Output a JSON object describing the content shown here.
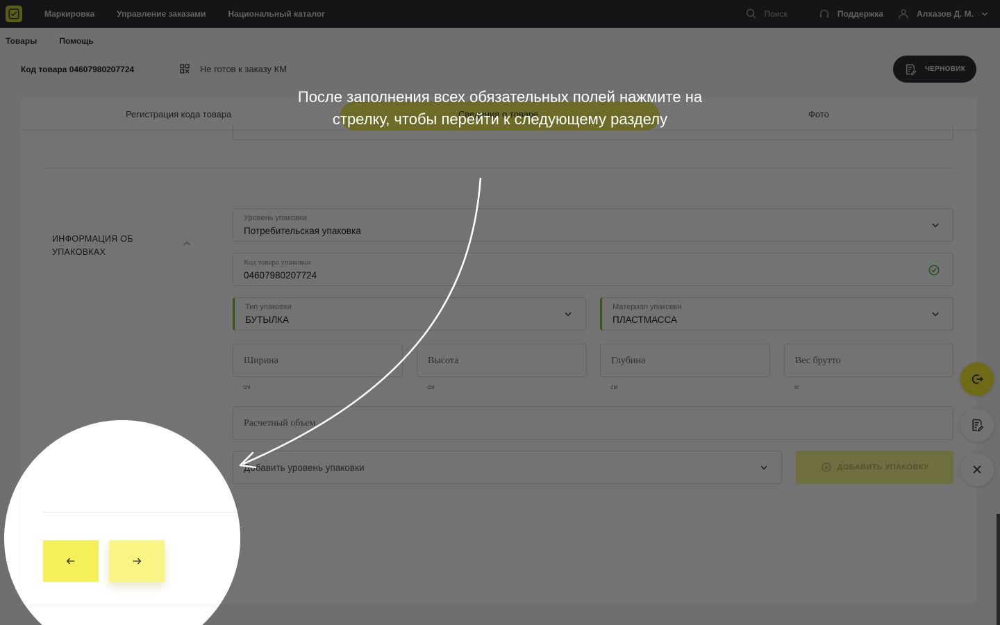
{
  "topbar": {
    "nav": [
      "Маркировка",
      "Управление заказами",
      "Национальный каталог"
    ],
    "search_label": "Поиск",
    "support_label": "Поддержка",
    "user_name": "Алхазов Д. М."
  },
  "subnav": [
    "Товары",
    "Помощь"
  ],
  "header": {
    "product_code": "Код товара 04607980207724",
    "km_status": "Не готов к заказу КМ",
    "draft_label": "ЧЕРНОВИК"
  },
  "tabs": [
    "Регистрация кода товара",
    "Сведения о товаре",
    "Фото"
  ],
  "section": {
    "title": "ИНФОРМАЦИЯ ОБ УПАКОВКАХ"
  },
  "form": {
    "package_level_label": "Уровень упаковки",
    "package_level_value": "Потребительская упаковка",
    "package_code_label": "Код товара упаковки",
    "package_code_value": "04607980207724",
    "package_type_label": "Тип упаковки",
    "package_type_value": "БУТЫЛКА",
    "material_label": "Материал упаковки",
    "material_value": "ПЛАСТМАССА",
    "width_placeholder": "Ширина",
    "height_placeholder": "Высота",
    "depth_placeholder": "Глубина",
    "weight_placeholder": "Вес брутто",
    "unit_cm": "см",
    "unit_kg": "кг",
    "volume_placeholder": "Расчетный объем",
    "add_level_placeholder": "Добавить уровень упаковки",
    "add_package_label": "ДОБАВИТЬ УПАКОВКУ"
  },
  "tutorial": {
    "hint": "После заполнения всех обязательных полей нажмите на стрелку, чтобы перейти к следующему разделу"
  },
  "colors": {
    "accent_yellow": "#f3ec2f",
    "topbar": "#2f3035",
    "valid_green": "#7dbb3f"
  },
  "icons": {
    "prev": "arrow-left-icon",
    "next": "arrow-right-icon",
    "close": "close-icon",
    "exit": "exit-icon",
    "draft": "document-edit-icon"
  }
}
